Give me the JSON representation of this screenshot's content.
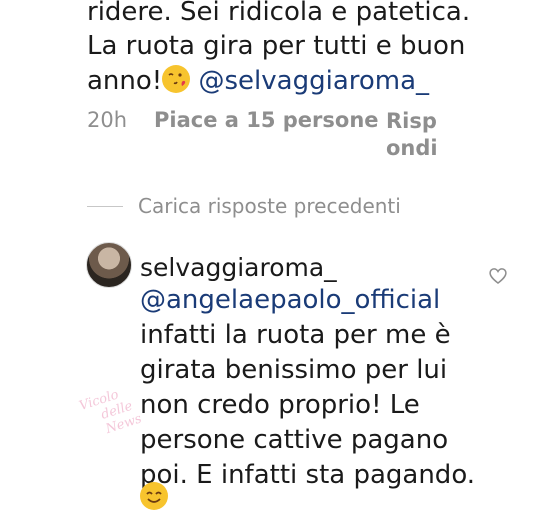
{
  "first_comment": {
    "line1": "ridere. Sei ridicola e patetica.",
    "line2": "La ruota gira per tutti e buon",
    "line3_prefix": "anno!",
    "emoji_name": "face-blowing-kiss-emoji",
    "mention": "@selvaggiaroma_",
    "time": "20h",
    "likes": "Piace a 15 persone",
    "reply_line1": "Risp",
    "reply_line2": "ondi"
  },
  "load_previous": "Carica risposte precedenti",
  "reply": {
    "username": "selvaggiaroma_",
    "mention": "@angelaepaolo_official",
    "lines": [
      "infatti la ruota per me è",
      "girata benissimo per lui",
      "non credo proprio! Le",
      "persone cattive pagano",
      "poi. E infatti sta pagando."
    ],
    "emoji_name": "smiling-face-emoji",
    "like_icon": "heart-outline-icon"
  },
  "watermark": {
    "line1": "Vicolo",
    "line2": "delle News"
  },
  "colors": {
    "text": "#1a1a1a",
    "mention": "#1a3b77",
    "meta": "#8e8e8e",
    "emoji": "#f7c42e"
  }
}
